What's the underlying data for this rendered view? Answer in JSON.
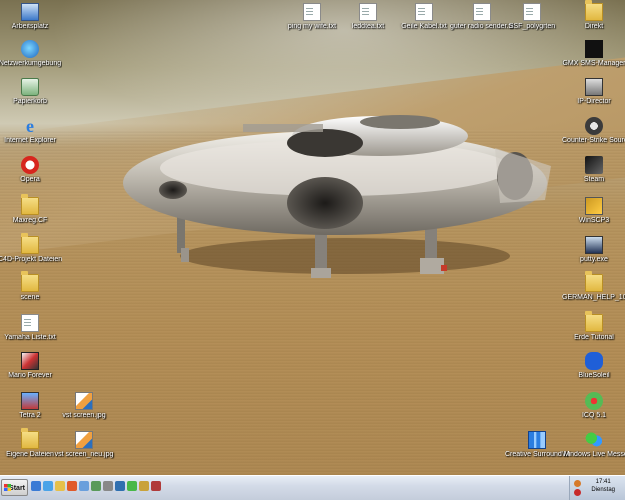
{
  "desktop_icons_left": [
    {
      "label": "Arbeitsplatz",
      "icon": "computer-icon"
    },
    {
      "label": "Netzwerkumgebung",
      "icon": "network-icon"
    },
    {
      "label": "Papierkorb",
      "icon": "recycle-bin-icon"
    },
    {
      "label": "Internet Explorer",
      "icon": "internet-explorer-icon"
    },
    {
      "label": "Opera",
      "icon": "opera-icon"
    },
    {
      "label": "Maxreg.CF",
      "icon": "folder-icon"
    },
    {
      "label": "C4D-Projekt Dateien",
      "icon": "folder-icon"
    },
    {
      "label": "scene",
      "icon": "folder-icon"
    },
    {
      "label": "Yamaha Liste.txt",
      "icon": "text-file-icon"
    },
    {
      "label": "Mario Forever",
      "icon": "game-icon"
    },
    {
      "label": "Tetra 2",
      "icon": "game-icon"
    },
    {
      "label": "Eigene Dateien",
      "icon": "folder-icon"
    }
  ],
  "desktop_icons_images": [
    {
      "label": "vst screen.jpg",
      "icon": "image-file-icon"
    },
    {
      "label": "vst screen_neu.jpg",
      "icon": "image-file-icon"
    }
  ],
  "desktop_icons_top": [
    {
      "label": "ping my wife.txt",
      "icon": "text-file-icon"
    },
    {
      "label": "leddtea.txt",
      "icon": "text-file-icon"
    },
    {
      "label": "Geile Kabel.txt",
      "icon": "text-file-icon"
    },
    {
      "label": "guter radio sender.txt",
      "icon": "text-file-icon"
    },
    {
      "label": "SSF_polygrten",
      "icon": "text-file-icon"
    }
  ],
  "desktop_icons_right": [
    {
      "label": "Direkt",
      "icon": "folder-icon"
    },
    {
      "label": "GMX SMS-Manager",
      "icon": "gmx-icon"
    },
    {
      "label": "IP-Director",
      "icon": "ip-director-icon"
    },
    {
      "label": "Counter-Strike Source",
      "icon": "counter-strike-icon"
    },
    {
      "label": "Steam",
      "icon": "steam-icon"
    },
    {
      "label": "WinSCP3",
      "icon": "winscp-icon"
    },
    {
      "label": "putty.exe",
      "icon": "putty-icon"
    },
    {
      "label": "GERMAN_HELP_10.0...",
      "icon": "folder-icon"
    },
    {
      "label": "Erde Tutorial",
      "icon": "folder-icon"
    },
    {
      "label": "BlueSoleil",
      "icon": "bluetooth-icon"
    },
    {
      "label": "ICQ 5.1",
      "icon": "icq-icon"
    },
    {
      "label": "Windows Live Messenger",
      "icon": "messenger-icon"
    }
  ],
  "desktop_icons_misc": [
    {
      "label": "Creative Surround Mixer",
      "icon": "mixer-icon"
    }
  ],
  "taskbar": {
    "start_label": "Start",
    "clock_time": "17:41",
    "clock_day": "Dienstag"
  },
  "colors": {
    "taskbar_bg": "#d3dbe8",
    "sand": "#b38d55",
    "sky": "#cfcab4"
  }
}
